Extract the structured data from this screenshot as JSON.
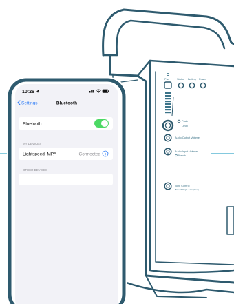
{
  "colors": {
    "outline": "#2e5a6e",
    "accent": "#3d7489",
    "connector": "#3aa9c9",
    "toggle_on": "#4cd964",
    "link_blue": "#2f7cf6",
    "screen_bg": "#f2f2f7"
  },
  "phone": {
    "status_time": "10:26",
    "back_label": "Settings",
    "title": "Bluetooth",
    "bluetooth_label": "Bluetooth",
    "bluetooth_on": true,
    "my_devices_header": "MY DEVICES",
    "device_name": "Lightspeed_MPA",
    "device_status": "Connected",
    "other_devices_header": "OTHER DEVICES"
  },
  "device": {
    "power_label": "Pwr",
    "indicators": [
      "Status",
      "Battery",
      "Power"
    ],
    "push_label": "Push",
    "level_label": "Level",
    "audio_output_label": "Audio Output Volume",
    "audio_input_label": "Audio Input Volume",
    "audio_input_sub": "Bluetooth",
    "tone_label": "Tone Control",
    "tone_sub": "(Bass/Mid/High + Headphone)"
  }
}
